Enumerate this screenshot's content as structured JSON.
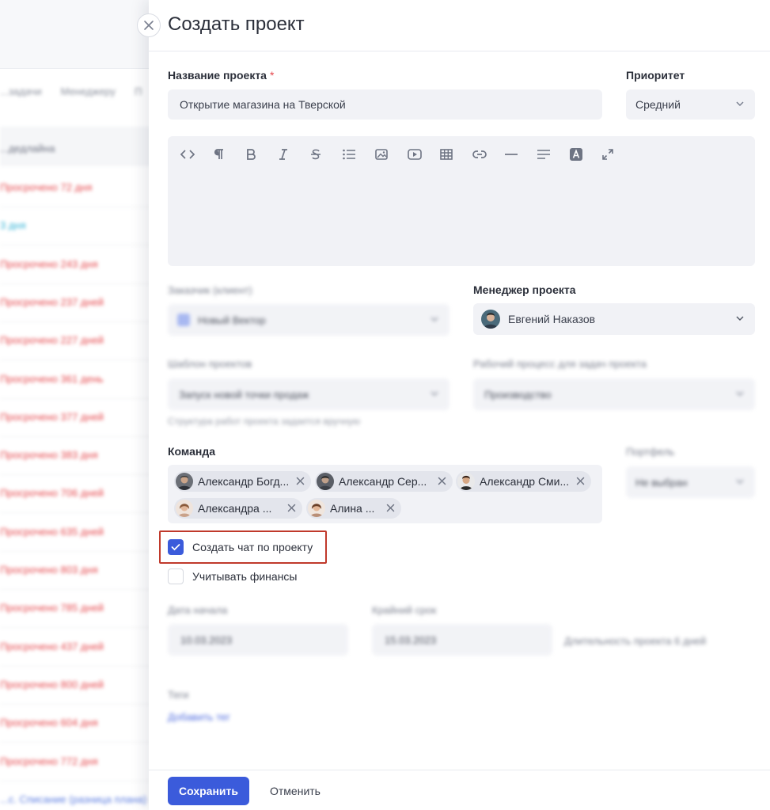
{
  "background": {
    "tabs": [
      "...задачи",
      "Менеджеру",
      "П"
    ],
    "column_header": "...дедлайна",
    "rows": [
      {
        "text": "Просрочено 72 дня",
        "color": "#e5484d"
      },
      {
        "text": "3 дня",
        "color": "#33b3d6"
      },
      {
        "text": "Просрочено 243 дня",
        "color": "#e5484d"
      },
      {
        "text": "Просрочено 237 дней",
        "color": "#e5484d"
      },
      {
        "text": "Просрочено 227 дней",
        "color": "#e5484d"
      },
      {
        "text": "Просрочено 361 день",
        "color": "#e5484d"
      },
      {
        "text": "Просрочено 377 дней",
        "color": "#e5484d"
      },
      {
        "text": "Просрочено 383 дня",
        "color": "#e5484d"
      },
      {
        "text": "Просрочено 706 дней",
        "color": "#e5484d"
      },
      {
        "text": "Просрочено 635 дней",
        "color": "#e5484d"
      },
      {
        "text": "Просрочено 803 дня",
        "color": "#e5484d"
      },
      {
        "text": "Просрочено 785 дней",
        "color": "#e5484d"
      },
      {
        "text": "Просрочено 437 дней",
        "color": "#e5484d"
      },
      {
        "text": "Просрочено 800 дней",
        "color": "#e5484d"
      },
      {
        "text": "Просрочено 604 дня",
        "color": "#e5484d"
      },
      {
        "text": "Просрочено 772 дня",
        "color": "#e5484d"
      },
      {
        "text": "...с. Списание (разница плана)",
        "color": "#5b7ce0"
      }
    ]
  },
  "modal": {
    "title": "Создать проект",
    "project_name": {
      "label": "Название проекта",
      "required_mark": "*",
      "value": "Открытие магазина на Тверской"
    },
    "priority": {
      "label": "Приоритет",
      "value": "Средний"
    },
    "editor": {
      "tools": [
        "code-icon",
        "paragraph-icon",
        "bold-icon",
        "italic-icon",
        "strikethrough-icon",
        "list-icon",
        "image-icon",
        "video-icon",
        "table-icon",
        "link-icon",
        "horizontal-rule-icon",
        "align-icon",
        "text-color-icon",
        "fullscreen-icon"
      ]
    },
    "client": {
      "label": "Заказчик (клиент)",
      "value": "Новый Вектор"
    },
    "manager": {
      "label": "Менеджер проекта",
      "value": "Евгений Наказов"
    },
    "template": {
      "label": "Шаблон проектов",
      "value": "Запуск новой точки продаж",
      "hint": "Структура работ проекта задается вручную"
    },
    "workflow": {
      "label": "Рабочий процесс для задач проекта",
      "value": "Производство"
    },
    "team": {
      "label": "Команда",
      "members": [
        "Александр Богд...",
        "Александр Сер...",
        "Александр Сми...",
        "Александра ...",
        "Алина ..."
      ]
    },
    "portfolio": {
      "label": "Портфель",
      "value": "Не выбран"
    },
    "create_chat": {
      "label": "Создать чат по проекту",
      "checked": true
    },
    "track_finances": {
      "label": "Учитывать финансы",
      "checked": false
    },
    "start_date": {
      "label": "Дата начала",
      "value": "10.03.2023"
    },
    "deadline": {
      "label": "Крайний срок",
      "value": "15.03.2023"
    },
    "duration_text": "Длительность проекта 6 дней",
    "tags": {
      "label": "Теги",
      "add_link": "Добавить тег"
    },
    "footer": {
      "save_label": "Сохранить",
      "cancel_label": "Отменить"
    }
  },
  "colors": {
    "accent": "#3b5bdb",
    "field_bg": "#f1f2f6",
    "required": "#e5484d",
    "highlight": "#c0392b"
  }
}
